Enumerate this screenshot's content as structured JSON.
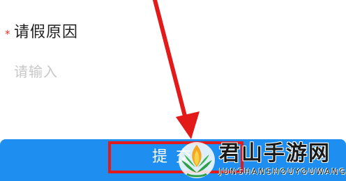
{
  "form": {
    "reason_label": "请假原因",
    "required_mark": "*",
    "reason_placeholder": "请输入"
  },
  "actions": {
    "submit_label": "提交"
  },
  "watermark": {
    "title": "君山手游网",
    "subtitle": "JUNSHANSHOUYOUWANG"
  },
  "colors": {
    "accent_blue": "#1f8ef1",
    "highlight_red": "#e21a1a",
    "required_red": "#e0342a",
    "placeholder_gray": "#c8c8c8"
  },
  "icons": {
    "annotation": "arrow-pointer-icon",
    "watermark": "flame-leaf-logo-icon"
  }
}
